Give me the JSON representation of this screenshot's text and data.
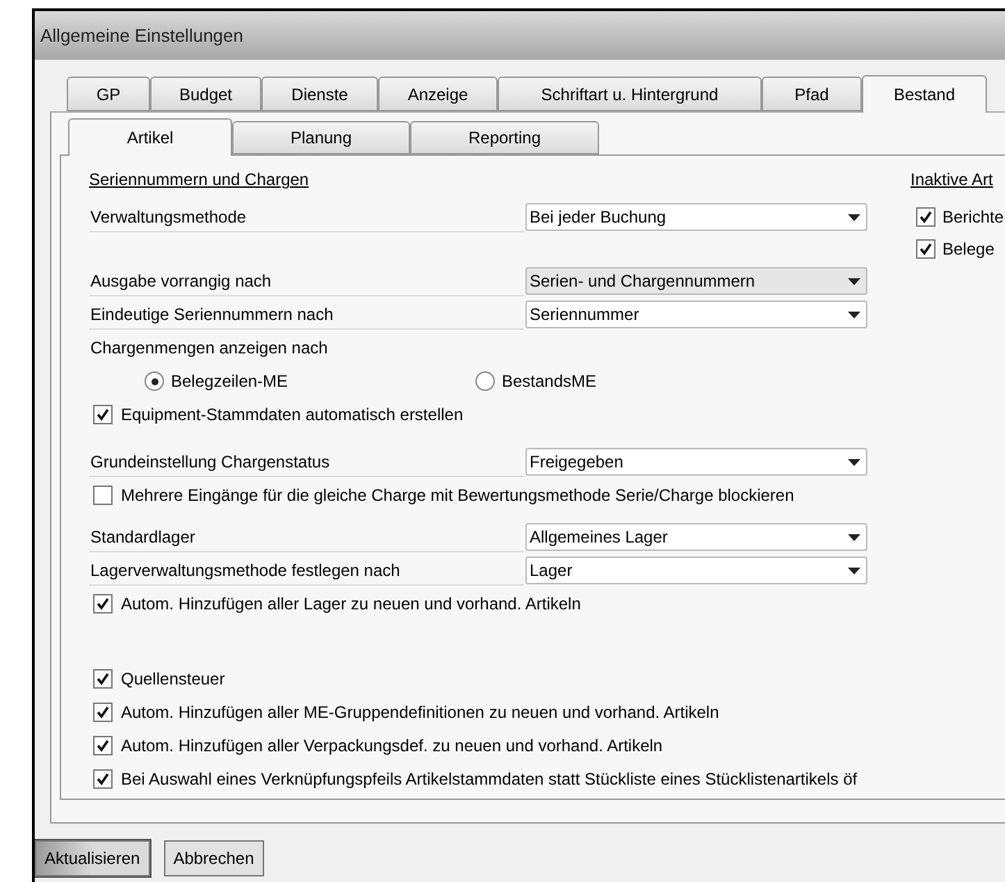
{
  "window": {
    "title": "Allgemeine Einstellungen"
  },
  "outer_tabs": [
    {
      "label": "GP",
      "selected": false
    },
    {
      "label": "Budget",
      "selected": false
    },
    {
      "label": "Dienste",
      "selected": false
    },
    {
      "label": "Anzeige",
      "selected": false
    },
    {
      "label": "Schriftart u. Hintergrund",
      "selected": false
    },
    {
      "label": "Pfad",
      "selected": false
    },
    {
      "label": "Bestand",
      "selected": true
    }
  ],
  "inner_tabs": [
    {
      "label": "Artikel",
      "selected": true
    },
    {
      "label": "Planung",
      "selected": false
    },
    {
      "label": "Reporting",
      "selected": false
    }
  ],
  "section_heading": "Seriennummern und Chargen",
  "groups": [
    [
      {
        "kind": "dropdown",
        "label": "Verwaltungsmethode",
        "value": "Bei jeder Buchung",
        "disabled": false
      }
    ],
    [
      {
        "kind": "dropdown",
        "label": "Ausgabe vorrangig nach",
        "value": "Serien- und Chargennummern",
        "disabled": true
      },
      {
        "kind": "dropdown",
        "label": "Eindeutige Seriennummern nach",
        "value": "Seriennummer",
        "disabled": false
      },
      {
        "kind": "text",
        "label": "Chargenmengen anzeigen nach"
      },
      {
        "kind": "radios",
        "options": [
          {
            "label": "Belegzeilen-ME",
            "selected": true
          },
          {
            "label": "BestandsME",
            "selected": false
          }
        ]
      },
      {
        "kind": "checkbox",
        "label": "Equipment-Stammdaten automatisch erstellen",
        "checked": true
      }
    ],
    [
      {
        "kind": "dropdown",
        "label": "Grundeinstellung Chargenstatus",
        "value": "Freigegeben",
        "disabled": false
      },
      {
        "kind": "checkbox",
        "label": "Mehrere Eingänge für die gleiche Charge mit Bewertungsmethode Serie/Charge blockieren",
        "checked": false
      }
    ],
    [
      {
        "kind": "dropdown",
        "label": "Standardlager",
        "value": "Allgemeines Lager",
        "disabled": false
      },
      {
        "kind": "dropdown",
        "label": "Lagerverwaltungsmethode festlegen nach",
        "value": "Lager",
        "disabled": false
      },
      {
        "kind": "checkbox",
        "label": "Autom. Hinzufügen aller Lager zu neuen und vorhand. Artikeln",
        "checked": true
      }
    ],
    [
      {
        "kind": "checkbox",
        "label": "Quellensteuer",
        "checked": true
      },
      {
        "kind": "checkbox",
        "label": "Autom. Hinzufügen aller ME-Gruppendefinitionen zu neuen und vorhand. Artikeln",
        "checked": true
      },
      {
        "kind": "checkbox",
        "label": "Autom. Hinzufügen aller Verpackungsdef. zu neuen und vorhand. Artikeln",
        "checked": true
      },
      {
        "kind": "checkbox",
        "label": "Bei Auswahl eines Verknüpfungspfeils Artikelstammdaten statt Stückliste eines Stücklistenartikels öf",
        "checked": true
      }
    ]
  ],
  "side": {
    "heading": "Inaktive Art",
    "checks": [
      {
        "label": "Berichte",
        "checked": true
      },
      {
        "label": "Belege",
        "checked": true
      }
    ]
  },
  "buttons": [
    {
      "label": "Aktualisieren",
      "focused": true
    },
    {
      "label": "Abbrechen",
      "focused": false
    }
  ]
}
